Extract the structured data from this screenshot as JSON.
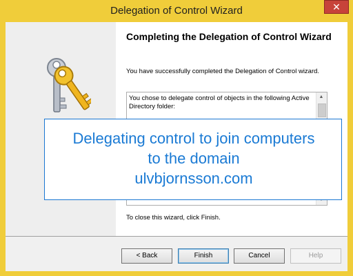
{
  "window": {
    "title": "Delegation of Control Wizard",
    "close_label": "✕"
  },
  "wizard": {
    "heading": "Completing the Delegation of Control Wizard",
    "success_message": "You have successfully completed the Delegation of Control wizard.",
    "summary_text": "You chose to delegate control of objects in the following Active Directory folder:",
    "close_hint": "To close this wizard, click Finish."
  },
  "buttons": {
    "back": "< Back",
    "finish": "Finish",
    "cancel": "Cancel",
    "help": "Help"
  },
  "overlay": {
    "line1": "Delegating control to join computers",
    "line2": "to the domain",
    "line3": "ulvbjornsson.com"
  },
  "icons": {
    "wizard_graphic": "keys-icon",
    "scroll_up": "chevron-up-icon",
    "scroll_down": "chevron-down-icon"
  },
  "colors": {
    "titlebar": "#f0cd3a",
    "close_button": "#c7433a",
    "overlay_text": "#1a7ad4",
    "overlay_border": "#1876d2"
  }
}
